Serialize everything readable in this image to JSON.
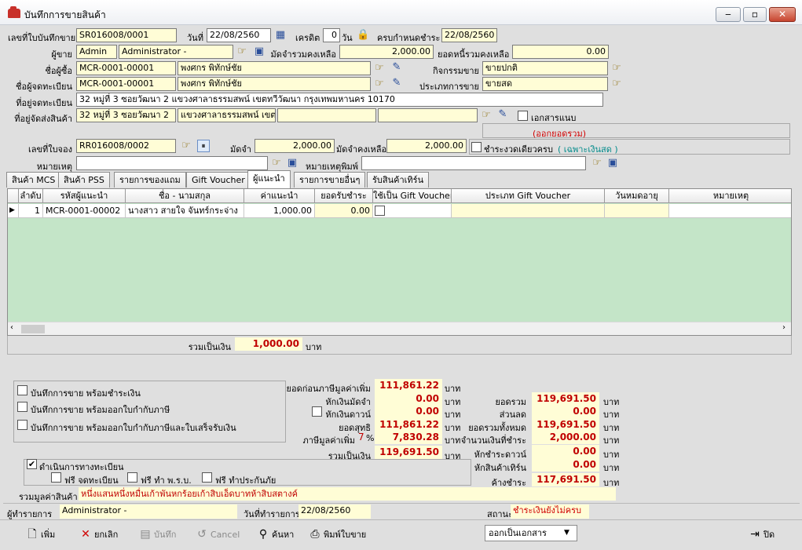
{
  "window": {
    "title": "บันทึกการขายสินค้า"
  },
  "header": {
    "doc_no_label": "เลขที่ใบบันทึกขาย",
    "doc_no": "SR016008/0001",
    "date_label": "วันที่",
    "date": "22/08/2560",
    "credit_label": "เครดิต",
    "credit": "0",
    "credit_unit": "วัน",
    "due_label": "ครบกำหนดชำระ",
    "due_date": "22/08/2560",
    "seller_label": "ผู้ขาย",
    "seller_code": "Admin",
    "seller_name": "Administrator -",
    "deposit_label": "มัดจำรวมคงเหลือ",
    "deposit_remaining": "2,000.00",
    "debt_label": "ยอดหนี้รวมคงเหลือ",
    "debt_remaining": "0.00",
    "buyer_label": "ชื่อผู้ซื้อ",
    "buyer_code": "MCR-0001-00001",
    "buyer_name": "พงศกร พิทักษ์ชัย",
    "activity_label": "กิจกรรมขาย",
    "activity": "ขายปกติ",
    "registrant_label": "ชื่อผู้จดทะเบียน",
    "registrant_code": "MCR-0001-00001",
    "registrant_name": "พงศกร พิทักษ์ชัย",
    "sale_type_label": "ประเภทการขาย",
    "sale_type": "ขายสด",
    "reg_address_label": "ที่อยู่จดทะเบียน",
    "reg_address": "32 หมู่ที่ 3 ซอยวัฒนา 2 แขวงศาลาธรรมสพน์ เขตทวีวัฒนา กรุงเทพมหานคร 10170",
    "ship_address_label": "ที่อยู่จัดส่งสินค้า",
    "ship_address_1": "32 หมู่ที่ 3 ซอยวัฒนา 2",
    "ship_address_2": "แขวงศาลาธรรมสพน์ เขตท",
    "attach_label": "เอกสารแนบ",
    "cancel_note": "(ออกยอดรวม)",
    "booking_label": "เลขที่ใบจอง",
    "booking_no": "RR016008/0002",
    "booking_deposit_label": "มัดจำ",
    "booking_deposit": "2,000.00",
    "booking_remaining_label": "มัดจำคงเหลือ",
    "booking_remaining": "2,000.00",
    "single_pay_label": "ชำระงวดเดียวครบ",
    "cash_only_note": "( เฉพาะเงินสด )",
    "remark_label": "หมายเหตุ",
    "print_remark_label": "หมายเหตุพิมพ์"
  },
  "tabs": [
    {
      "label": "สินค้า MCS"
    },
    {
      "label": "สินค้า PSS"
    },
    {
      "label": "รายการของแถม"
    },
    {
      "label": "Gift Voucher"
    },
    {
      "label": "ผู้แนะนำ"
    },
    {
      "label": "รายการขายอื่นๆ"
    },
    {
      "label": "รับสินค้าเทิร์น"
    }
  ],
  "grid": {
    "columns": [
      {
        "label": "ลำดับ"
      },
      {
        "label": "รหัสผู้แนะนำ"
      },
      {
        "label": "ชื่อ - นามสกุล"
      },
      {
        "label": "ค่าแนะนำ"
      },
      {
        "label": "ยอดรับชำระ"
      },
      {
        "label": "ใช้เป็น Gift Voucher"
      },
      {
        "label": "ประเภท Gift Voucher"
      },
      {
        "label": "วันหมดอายุ"
      },
      {
        "label": "หมายเหตุ"
      }
    ],
    "rows": [
      {
        "no": "1",
        "code": "MCR-0001-00002",
        "name": "นางสาว สายใจ จันทร์กระจ่าง",
        "fee": "1,000.00",
        "paid": "0.00",
        "gift": "",
        "gift_type": "",
        "expiry": "",
        "remark": ""
      }
    ],
    "total_label": "รวมเป็นเงิน",
    "total": "1,000.00",
    "total_unit": "บาท"
  },
  "options": {
    "save_with_payment": "บันทึกการขาย พร้อมชำระเงิน",
    "save_with_tax_invoice": "บันทึกการขาย พร้อมออกใบกำกับภาษี",
    "save_with_tax_receipt": "บันทึกการขาย พร้อมออกใบกำกับภาษีและใบเสร็จรับเงิน",
    "registration_label": "ดำเนินการทางทะเบียน",
    "registration_checked": "✔",
    "free_registration": "ฟรี จดทะเบียน",
    "free_act": "ฟรี ทำ พ.ร.บ.",
    "free_insurance": "ฟรี ทำประกันภัย"
  },
  "totals": {
    "pre_vat_label": "ยอดก่อนภาษีมูลค่าเพิ่ม",
    "pre_vat": "111,861.22",
    "deposit_deduct_label": "หักเงินมัดจำ",
    "deposit_deduct": "0.00",
    "down_deduct_label": "หักเงินดาวน์",
    "down_deduct": "0.00",
    "net_label": "ยอดสุทธิ",
    "net": "111,861.22",
    "vat_label": "ภาษีมูลค่าเพิ่ม",
    "vat_rate": "7",
    "vat_pct": "%",
    "vat": "7,830.28",
    "grand_label": "รวมเป็นเงิน",
    "grand": "119,691.50",
    "sum_label": "ยอดรวม",
    "sum": "119,691.50",
    "discount_label": "ส่วนลด",
    "discount": "0.00",
    "total_all_label": "ยอดรวมทั้งหมด",
    "total_all": "119,691.50",
    "pay_amount_label": "จำนวนเงินที่ชำระ",
    "pay_amount": "2,000.00",
    "down_pay_label": "หักชำระดาวน์",
    "down_pay": "0.00",
    "turn_label": "หักสินค้าเทิร์น",
    "turn": "0.00",
    "outstanding_label": "ค้างชำระ",
    "outstanding": "117,691.50",
    "unit": "บาท",
    "words_label": "รวมมูลค่าสินค้า",
    "words": "หนึ่งแสนหนึ่งหมื่นเก้าพันหกร้อยเก้าสิบเอ็ดบาทห้าสิบสตางค์"
  },
  "footer": {
    "recorder_label": "ผู้ทำรายการ",
    "recorder": "Administrator -",
    "record_date_label": "วันที่ทำรายการ",
    "record_date": "22/08/2560",
    "status_label": "สถานะ",
    "status": "ชำระเงินยังไม่ครบ"
  },
  "toolbar": {
    "add": "เพิ่ม",
    "cancel_doc": "ยกเลิก",
    "save": "บันทึก",
    "cancel": "Cancel",
    "search": "ค้นหา",
    "print": "พิมพ์ใบขาย",
    "export_select": "ออกเป็นเอกสาร",
    "close": "ปิด"
  }
}
